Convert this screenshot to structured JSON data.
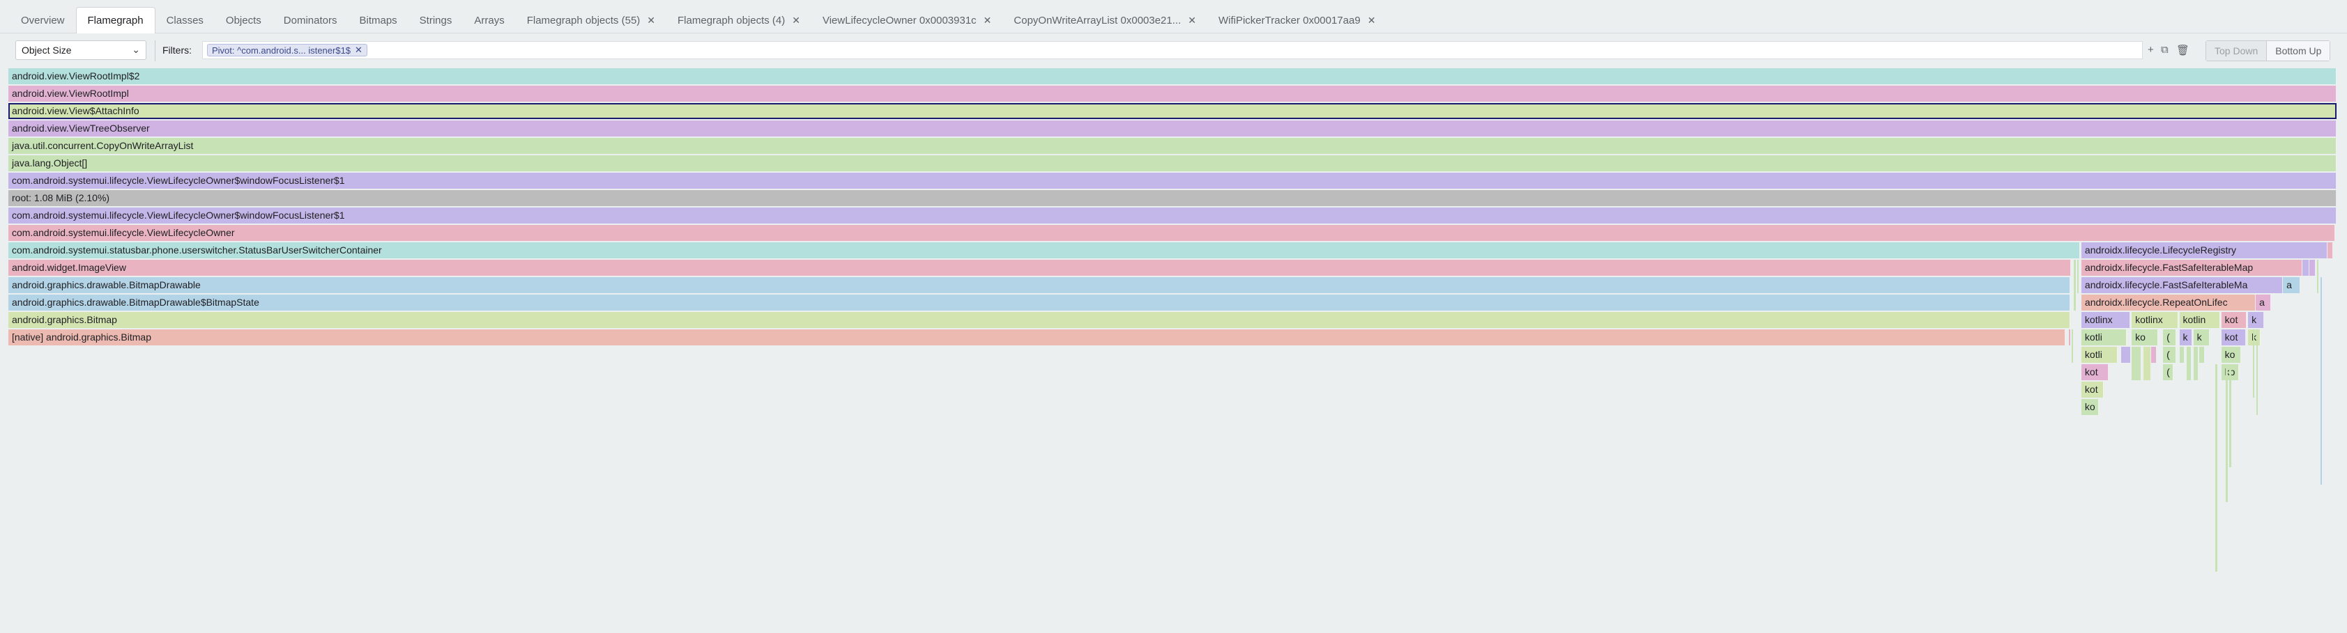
{
  "tabs": [
    {
      "label": "Overview",
      "active": false,
      "closable": false
    },
    {
      "label": "Flamegraph",
      "active": true,
      "closable": false
    },
    {
      "label": "Classes",
      "active": false,
      "closable": false
    },
    {
      "label": "Objects",
      "active": false,
      "closable": false
    },
    {
      "label": "Dominators",
      "active": false,
      "closable": false
    },
    {
      "label": "Bitmaps",
      "active": false,
      "closable": false
    },
    {
      "label": "Strings",
      "active": false,
      "closable": false
    },
    {
      "label": "Arrays",
      "active": false,
      "closable": false
    },
    {
      "label": "Flamegraph objects (55)",
      "active": false,
      "closable": true
    },
    {
      "label": "Flamegraph objects (4)",
      "active": false,
      "closable": true
    },
    {
      "label": "ViewLifecycleOwner 0x0003931c",
      "active": false,
      "closable": true
    },
    {
      "label": "CopyOnWriteArrayList 0x0003e21...",
      "active": false,
      "closable": true
    },
    {
      "label": "WifiPickerTracker 0x00017aa9",
      "active": false,
      "closable": true
    }
  ],
  "toolbar": {
    "metric_select": "Object Size",
    "filters_label": "Filters:",
    "filter_chip": "Pivot: ^com.android.s... istener$1$",
    "mode_top_down": "Top Down",
    "mode_bottom_up": "Bottom Up",
    "active_mode": "Bottom Up"
  },
  "colors": {
    "teal": "#b3e0dc",
    "pink": "#e3b2d2",
    "lime": "#d3e4b1",
    "lilac": "#d0b3e2",
    "green": "#c7e2b5",
    "gray": "#bcbcbc",
    "violet": "#c3b6e8",
    "rose": "#e9b3c1",
    "blue": "#b3d3e6",
    "salmon": "#edbab2",
    "selection": "#1a1a6e"
  },
  "flamegraph": {
    "frames": [
      {
        "label": "android.view.ViewRootImpl$2",
        "color": "teal",
        "row": 0,
        "start": 0.0,
        "end": 1.0,
        "selected": false
      },
      {
        "label": "android.view.ViewRootImpl",
        "color": "pink",
        "row": 1,
        "start": 0.0,
        "end": 1.0,
        "selected": false
      },
      {
        "label": "android.view.View$AttachInfo",
        "color": "lime",
        "row": 2,
        "start": 0.0,
        "end": 1.0,
        "selected": true
      },
      {
        "label": "android.view.ViewTreeObserver",
        "color": "lilac",
        "row": 3,
        "start": 0.0,
        "end": 1.0,
        "selected": false
      },
      {
        "label": "java.util.concurrent.CopyOnWriteArrayList",
        "color": "green",
        "row": 4,
        "start": 0.0,
        "end": 1.0,
        "selected": false
      },
      {
        "label": "java.lang.Object[]",
        "color": "green",
        "row": 5,
        "start": 0.0,
        "end": 1.0,
        "selected": false
      },
      {
        "label": "com.android.systemui.lifecycle.ViewLifecycleOwner$windowFocusListener$1",
        "color": "violet",
        "row": 6,
        "start": 0.0,
        "end": 1.0,
        "selected": false
      },
      {
        "label": "root: 1.08 MiB (2.10%)",
        "color": "gray",
        "row": 7,
        "start": 0.0,
        "end": 1.0,
        "selected": false
      },
      {
        "label": "com.android.systemui.lifecycle.ViewLifecycleOwner$windowFocusListener$1",
        "color": "violet",
        "row": 8,
        "start": 0.0,
        "end": 1.0,
        "selected": false
      },
      {
        "label": "com.android.systemui.lifecycle.ViewLifecycleOwner",
        "color": "rose",
        "row": 9,
        "start": 0.0,
        "end": 0.9995,
        "selected": false
      },
      {
        "label": "com.android.systemui.statusbar.phone.userswitcher.StatusBarUserSwitcherContainer",
        "color": "teal",
        "row": 10,
        "start": 0.0,
        "end": 0.8897,
        "selected": false
      },
      {
        "label": "androidx.lifecycle.LifecycleRegistry",
        "color": "violet",
        "row": 10,
        "start": 0.8904,
        "end": 0.9962,
        "selected": false
      },
      {
        "label": "",
        "color": "rose",
        "row": 10,
        "start": 0.9962,
        "end": 0.9985,
        "selected": false
      },
      {
        "label": "android.widget.ImageView",
        "color": "rose",
        "row": 11,
        "start": 0.0,
        "end": 0.8859,
        "selected": false
      },
      {
        "label": "androidx.lifecycle.FastSafeIterableMap",
        "color": "rose",
        "row": 11,
        "start": 0.8904,
        "end": 0.9853,
        "selected": false
      },
      {
        "label": "",
        "color": "violet",
        "row": 11,
        "start": 0.9853,
        "end": 0.9883,
        "selected": false
      },
      {
        "label": "",
        "color": "lilac",
        "row": 11,
        "start": 0.9883,
        "end": 0.991,
        "selected": false
      },
      {
        "label": "android.graphics.drawable.BitmapDrawable",
        "color": "blue",
        "row": 12,
        "start": 0.0,
        "end": 0.8855,
        "selected": false
      },
      {
        "label": "androidx.lifecycle.FastSafeIterableMa",
        "color": "violet",
        "row": 12,
        "start": 0.8904,
        "end": 0.977,
        "selected": false
      },
      {
        "label": "a",
        "color": "blue",
        "row": 12,
        "start": 0.977,
        "end": 0.9845,
        "selected": false
      },
      {
        "label": "android.graphics.drawable.BitmapDrawable$BitmapState",
        "color": "blue",
        "row": 13,
        "start": 0.0,
        "end": 0.8855,
        "selected": false
      },
      {
        "label": "androidx.lifecycle.RepeatOnLifec",
        "color": "salmon",
        "row": 13,
        "start": 0.8904,
        "end": 0.9653,
        "selected": false
      },
      {
        "label": "a",
        "color": "pink",
        "row": 13,
        "start": 0.9653,
        "end": 0.9718,
        "selected": false
      },
      {
        "label": "android.graphics.Bitmap",
        "color": "lime",
        "row": 14,
        "start": 0.0,
        "end": 0.8855,
        "selected": false
      },
      {
        "label": "kotlinx",
        "color": "violet",
        "row": 14,
        "start": 0.8904,
        "end": 0.9115,
        "selected": false
      },
      {
        "label": "kotlinx",
        "color": "lime",
        "row": 14,
        "start": 0.912,
        "end": 0.932,
        "selected": false
      },
      {
        "label": "kotlin",
        "color": "lime",
        "row": 14,
        "start": 0.9325,
        "end": 0.95,
        "selected": false
      },
      {
        "label": "kot",
        "color": "rose",
        "row": 14,
        "start": 0.9505,
        "end": 0.9615,
        "selected": false
      },
      {
        "label": "k",
        "color": "violet",
        "row": 14,
        "start": 0.962,
        "end": 0.969,
        "selected": false
      },
      {
        "label": "[native] android.graphics.Bitmap",
        "color": "salmon",
        "row": 15,
        "start": 0.0,
        "end": 0.8834,
        "selected": false
      },
      {
        "label": "kotli",
        "color": "green",
        "row": 15,
        "start": 0.8904,
        "end": 0.91,
        "selected": false
      },
      {
        "label": "ko",
        "color": "green",
        "row": 15,
        "start": 0.912,
        "end": 0.9235,
        "selected": false
      },
      {
        "label": "(",
        "color": "green",
        "row": 15,
        "start": 0.9255,
        "end": 0.931,
        "selected": false
      },
      {
        "label": "k",
        "color": "violet",
        "row": 15,
        "start": 0.9325,
        "end": 0.938,
        "selected": false
      },
      {
        "label": "k",
        "color": "green",
        "row": 15,
        "start": 0.9385,
        "end": 0.9455,
        "selected": false
      },
      {
        "label": "kot",
        "color": "violet",
        "row": 15,
        "start": 0.9505,
        "end": 0.961,
        "selected": false
      },
      {
        "label": "k",
        "color": "lime",
        "row": 15,
        "start": 0.962,
        "end": 0.9675,
        "selected": false
      },
      {
        "label": "kotli",
        "color": "lime",
        "row": 16,
        "start": 0.8904,
        "end": 0.906,
        "selected": false
      },
      {
        "label": "(",
        "color": "green",
        "row": 16,
        "start": 0.9255,
        "end": 0.931,
        "selected": false
      },
      {
        "label": "ko",
        "color": "green",
        "row": 16,
        "start": 0.9505,
        "end": 0.959,
        "selected": false
      },
      {
        "label": "kot",
        "color": "pink",
        "row": 17,
        "start": 0.8904,
        "end": 0.902,
        "selected": false
      },
      {
        "label": "(",
        "color": "green",
        "row": 17,
        "start": 0.9255,
        "end": 0.93,
        "selected": false
      },
      {
        "label": "ko",
        "color": "green",
        "row": 17,
        "start": 0.9505,
        "end": 0.958,
        "selected": false
      },
      {
        "label": "kot",
        "color": "lime",
        "row": 18,
        "start": 0.8904,
        "end": 0.9,
        "selected": false
      },
      {
        "label": "ko",
        "color": "green",
        "row": 19,
        "start": 0.8904,
        "end": 0.898,
        "selected": false
      }
    ],
    "slivers": [
      {
        "color": "green",
        "row": 11,
        "start": 0.8872,
        "end": 0.888,
        "depth": 3
      },
      {
        "color": "green",
        "row": 11,
        "start": 0.8886,
        "end": 0.8892,
        "depth": 2
      },
      {
        "color": "green",
        "row": 11,
        "start": 0.9915,
        "end": 0.9921,
        "depth": 2
      },
      {
        "color": "blue",
        "row": 12,
        "start": 0.993,
        "end": 0.9936,
        "depth": 12
      },
      {
        "color": "rose",
        "row": 15,
        "start": 0.885,
        "end": 0.8856,
        "depth": 1
      },
      {
        "color": "green",
        "row": 15,
        "start": 0.8862,
        "end": 0.8867,
        "depth": 2
      },
      {
        "color": "violet",
        "row": 16,
        "start": 0.9075,
        "end": 0.9115,
        "depth": 1
      },
      {
        "color": "green",
        "row": 16,
        "start": 0.912,
        "end": 0.916,
        "depth": 2
      },
      {
        "color": "lime",
        "row": 16,
        "start": 0.917,
        "end": 0.92,
        "depth": 2
      },
      {
        "color": "pink",
        "row": 16,
        "start": 0.9205,
        "end": 0.9225,
        "depth": 1
      },
      {
        "color": "green",
        "row": 16,
        "start": 0.9325,
        "end": 0.9345,
        "depth": 1
      },
      {
        "color": "green",
        "row": 16,
        "start": 0.9355,
        "end": 0.9375,
        "depth": 2
      },
      {
        "color": "green",
        "row": 16,
        "start": 0.9385,
        "end": 0.9405,
        "depth": 2
      },
      {
        "color": "green",
        "row": 16,
        "start": 0.941,
        "end": 0.943,
        "depth": 1
      },
      {
        "color": "green",
        "row": 17,
        "start": 0.948,
        "end": 0.9488,
        "depth": 12
      },
      {
        "color": "green",
        "row": 17,
        "start": 0.9525,
        "end": 0.9533,
        "depth": 8
      },
      {
        "color": "green",
        "row": 17,
        "start": 0.954,
        "end": 0.9547,
        "depth": 6
      },
      {
        "color": "green",
        "row": 15,
        "start": 0.964,
        "end": 0.9646,
        "depth": 4
      },
      {
        "color": "green",
        "row": 15,
        "start": 0.9655,
        "end": 0.9661,
        "depth": 5
      }
    ]
  }
}
